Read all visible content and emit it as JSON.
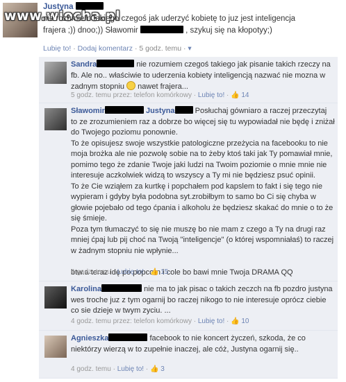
{
  "post": {
    "author": "Justyna",
    "watermark": "www.wiocha.pl",
    "line1": "nie rozumiem takiego czegoś jak uderzyć kobietę to juz jest inteligencja",
    "line2a": "frajera ;)) dnoo;)) Sławomir",
    "line2b": ", szykuj się na kłopotyy;)",
    "meta_like": "Lubię to!",
    "meta_comment": "Dodaj komentarz",
    "meta_time": "5 godz. temu",
    "meta_sep": "·"
  },
  "comments": [
    {
      "author": "Sandra",
      "text": "nie rozumiem czegoś takiego jak pisanie takich rzeczy na fb. Ale no.. właściwie to uderzenia kobiety inteligencją nazwać nie mozna w zadnym stopniu",
      "text_after_smile": "nawet frajera...",
      "time": "5 godz. temu przez: telefon komórkowy",
      "like": "Lubię to!",
      "likes": "14"
    },
    {
      "author": "Sławomir",
      "author2": "Justyna",
      "lines": [
        "Posłuchaj gówniaro a raczej przeczytaj to ze zrozumieniem raz a dobrze bo więcej się tu wypowiadał nie będę i zniżał do Twojego poziomu ponownie.",
        "To że opisujesz swoje wszystkie patologiczne przeżycia na facebooku to nie moja brożka ale nie pozwolę sobie na to żeby ktoś taki jak Ty pomawiał mnie, pomimo tego że zdanie Twoje jaki ludzi na Twoim poziomie o mnie mnie nie interesuje aczkolwiek widzą to wszyscy a Ty mi nie będziesz psuć opinii.",
        "To że Cie wziąłem za kurtkę i popchałem pod kapslem to fakt i się tego nie wypieram i gdyby była podobna syt.zrobiłbym to samo bo Ci się chyba w głowie pojebało od tego ćpania i alkoholu że będziesz skakać do mnie o to że się śmieje.",
        "Poza tym tłumaczyć to się nie muszę bo nie mam z czego a Ty na drugi raz mniej ćpaj lub pij choć na Twoją \"inteligencje\" (o której wspomniałaś) to raczej w żadnym stopniu nie wpłynie...",
        "btw.a teraz idę po popcorn i cole bo bawi mnie Twoja DRAMA QQ"
      ],
      "time": "4 godz. temu",
      "like": "Lubię to!",
      "likes": "15"
    },
    {
      "author": "Karolina",
      "text": "nie ma to jak pisac o takich zeczch na fb pozdro justyna wes troche juz z tym ogarnij bo raczej nikogo to nie interesuje oprócz ciebie co sie dzieje w twym zyciu. ...",
      "time": "4 godz. temu przez: telefon komórkowy",
      "like": "Lubię to!",
      "likes": "10"
    },
    {
      "author": "Agnieszka",
      "text": "facebook to nie koncert życzeń, szkoda, że co niektórzy wierzą w to zupełnie inaczej, ale cóż, Justyna ogarnij się..",
      "time": "4 godz. temu",
      "like": "Lubię to!",
      "likes": "3"
    }
  ],
  "colors": {
    "link": "#3b5998",
    "comment_bg": "#edeff4",
    "meta": "#999999"
  }
}
